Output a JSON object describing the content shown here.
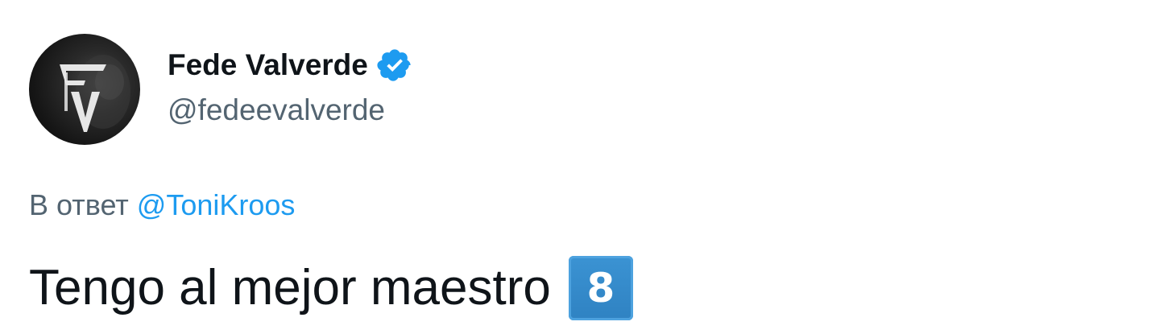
{
  "author": {
    "display_name": "Fede Valverde",
    "handle": "@fedeevalverde",
    "verified": true,
    "verified_icon": "verified-badge-icon",
    "avatar_icon": "avatar-fv-logo"
  },
  "reply": {
    "prefix": "В ответ ",
    "to_handle": "@ToniKroos"
  },
  "tweet": {
    "text": "Tengo al mejor maestro",
    "emoji": "8"
  },
  "colors": {
    "text_primary": "#0f1419",
    "text_secondary": "#536471",
    "link": "#1d9bf0",
    "verified": "#1d9bf0",
    "keycap": "#3b8fd0"
  }
}
